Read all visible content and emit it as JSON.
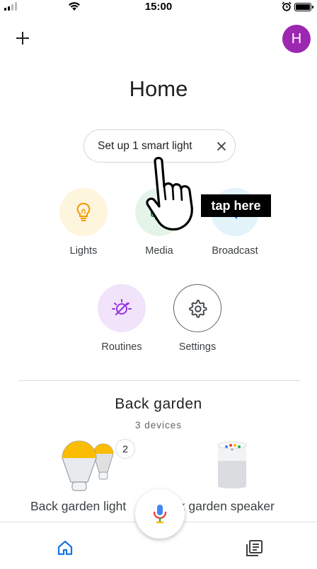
{
  "status_bar": {
    "time": "15:00"
  },
  "header": {
    "avatar_initial": "H"
  },
  "page": {
    "title": "Home"
  },
  "setup_chip": {
    "label": "Set up 1 smart light"
  },
  "annotation": {
    "label": "tap here"
  },
  "shortcuts": [
    {
      "label": "Lights",
      "icon": "lightbulb-icon"
    },
    {
      "label": "Media",
      "icon": "media-icon"
    },
    {
      "label": "Broadcast",
      "icon": "broadcast-icon"
    },
    {
      "label": "Routines",
      "icon": "routines-icon"
    },
    {
      "label": "Settings",
      "icon": "gear-icon"
    }
  ],
  "room": {
    "name": "Back garden",
    "device_count": "3 devices",
    "devices": [
      {
        "label": "Back garden light",
        "badge": "2"
      },
      {
        "label": "ck garden speaker"
      }
    ]
  },
  "colors": {
    "avatar": "#9c27b0",
    "nav_active": "#1a73e8",
    "lights_bg": "#fef5dd",
    "media_bg": "#e4f4e8",
    "broadcast_bg": "#e2f3f9",
    "routines_bg": "#f1e3fa"
  },
  "bottom_nav": {
    "items": [
      "home-icon",
      "feed-icon"
    ]
  }
}
